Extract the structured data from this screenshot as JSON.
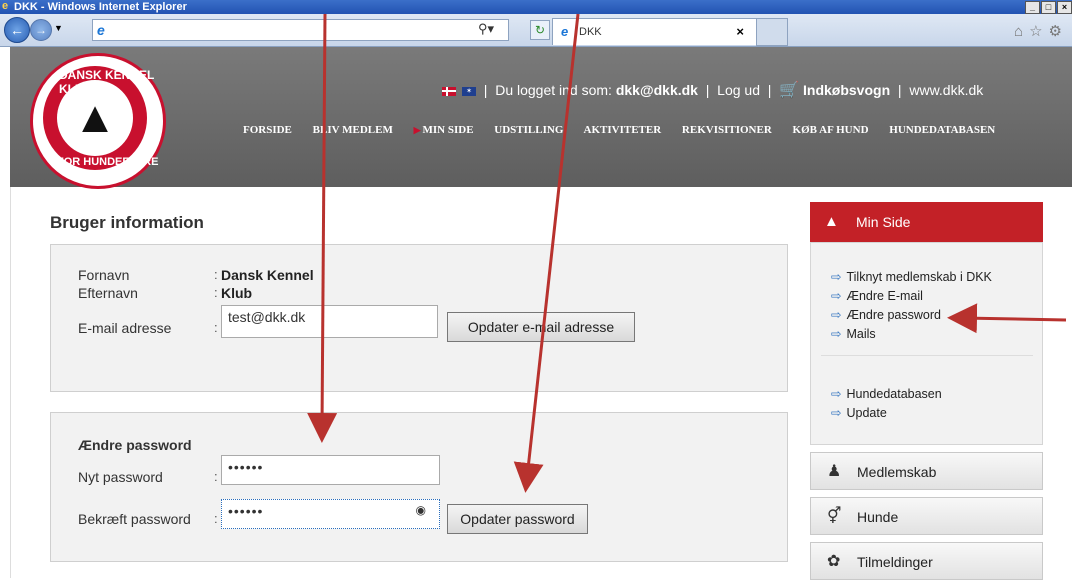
{
  "window": {
    "title": "DKK - Windows Internet Explorer",
    "controls": [
      "_",
      "□",
      "×"
    ]
  },
  "browser": {
    "tab_label": "DKK",
    "address_value": "",
    "close_tab": "×",
    "right_icons": "⌂☆⚙"
  },
  "header": {
    "logo_top": "DANSK KENNEL KLUB",
    "logo_bottom": "FOR HUNDEEJERE",
    "logged_in_prefix": "Du logget ind som:",
    "logged_in_user": "dkk@dkk.dk",
    "logout": "Log ud",
    "cart": "Indkøbsvogn",
    "site": "www.dkk.dk",
    "menu": [
      "FORSIDE",
      "BLIV MEDLEM",
      "MIN SIDE",
      "UDSTILLING",
      "AKTIVITETER",
      "REKVISITIONER",
      "KØB AF HUND",
      "HUNDEDATABASEN"
    ]
  },
  "user_info": {
    "title": "Bruger information",
    "fornavn_label": "Fornavn",
    "fornavn_value": "Dansk Kennel",
    "efternavn_label": "Efternavn",
    "efternavn_value": "Klub",
    "email_label": "E-mail adresse",
    "email_value": "test@dkk.dk",
    "update_email_button": "Opdater e-mail adresse"
  },
  "password": {
    "title": "Ændre password",
    "new_label": "Nyt password",
    "new_value": "••••••",
    "confirm_label": "Bekræft password",
    "confirm_value": "••••••",
    "update_button": "Opdater password"
  },
  "sidebar": {
    "header": "Min Side",
    "links": [
      "Tilknyt medlemskab i DKK",
      "Ændre E-mail",
      "Ændre password",
      "Mails",
      "Hundedatabasen",
      "Update"
    ],
    "buttons": [
      "Medlemskab",
      "Hunde",
      "Tilmeldinger"
    ]
  },
  "colors": {
    "accent_red": "#c32127",
    "arrow_red": "#b8322e",
    "header_gray": "#6b6b6b"
  }
}
